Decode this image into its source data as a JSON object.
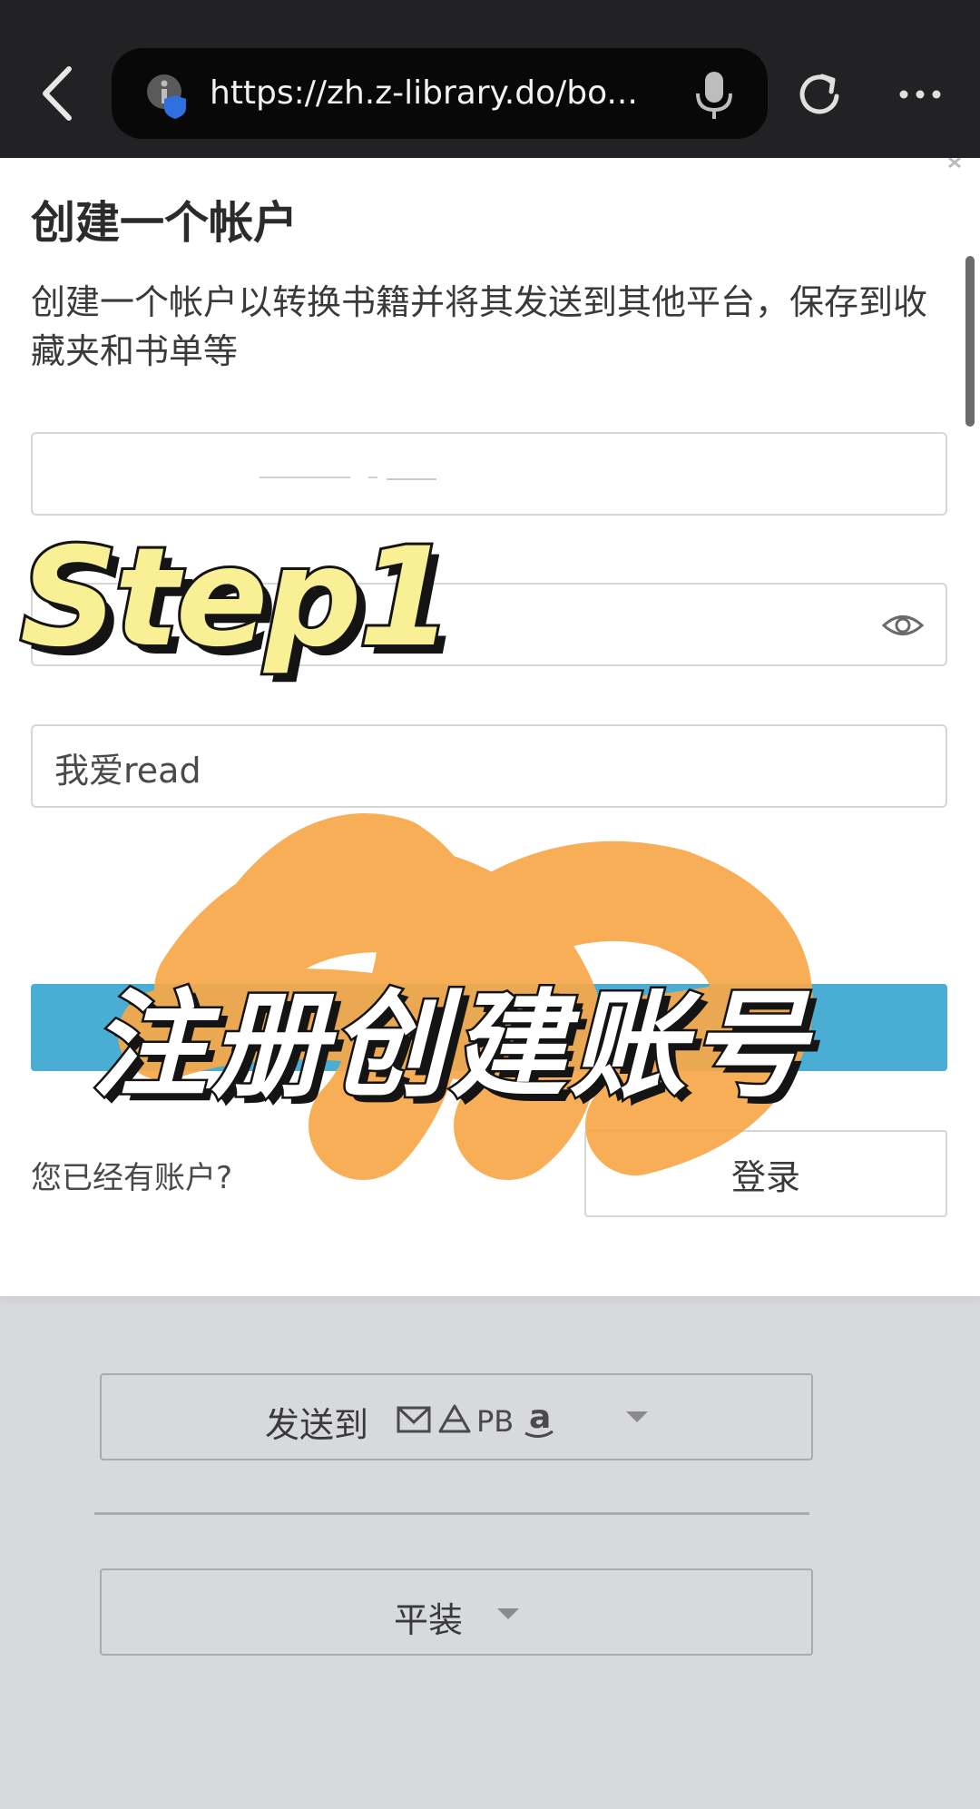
{
  "browser": {
    "url": "https://zh.z-library.do/bo..."
  },
  "modal": {
    "title": "创建一个帐户",
    "description": "创建一个帐户以转换书籍并将其发送到其他平台，保存到收藏夹和书单等",
    "email_value": "",
    "password_value": "",
    "name_value": "我爱read",
    "signin_prompt": "您已经有账户?",
    "login_label": "登录"
  },
  "background_page": {
    "send_to_label": "发送到",
    "send_icons": [
      "mail-icon",
      "google-drive-icon",
      "PB",
      "amazon-icon"
    ],
    "format_label": "平装"
  },
  "overlay": {
    "step_text": "Step1",
    "headline_text": "注册创建账号",
    "accent_color": "#f7a84a"
  },
  "colors": {
    "register_button": "#4aadd4",
    "top_bar": "#222224",
    "backdrop": "#d7d9dc"
  }
}
